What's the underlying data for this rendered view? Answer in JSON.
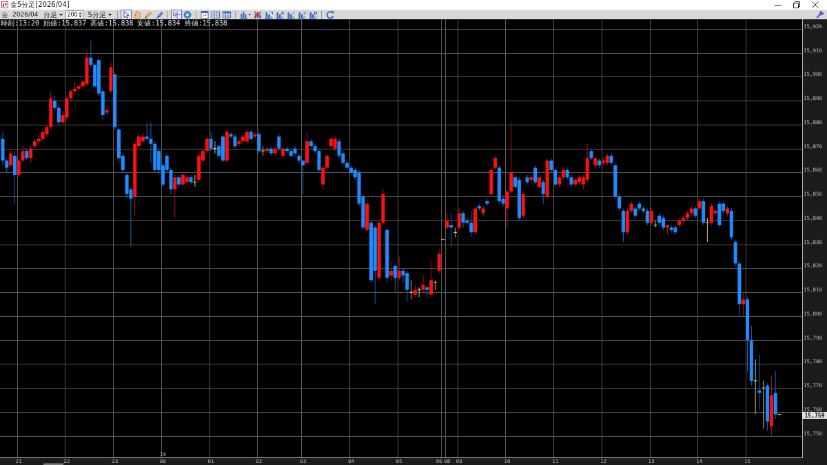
{
  "window": {
    "title": "金5分足[2026/04]"
  },
  "toolbar": {
    "symbol": "金",
    "contract": "2026/04",
    "unit": "分足",
    "bar_count": "200",
    "period": "5分足",
    "tools": [
      {
        "selected": true
      },
      {
        "selected": false
      },
      {
        "selected": false
      },
      {
        "selected": false
      },
      {
        "selected": true
      },
      {
        "selected": false
      },
      {
        "selected": false
      },
      {
        "selected": false
      },
      {
        "selected": false
      },
      {
        "selected": false
      },
      {
        "selected": false
      },
      {
        "selected": false
      },
      {
        "selected": false
      },
      {
        "selected": false
      },
      {
        "selected": false
      },
      {
        "selected": false
      },
      {
        "selected": false
      }
    ]
  },
  "chart": {
    "quote_line": "時刻:13:20 始値:15,837 高値:15,838 安値:15,834 終値:15,838",
    "chart_data": {
      "type": "candlestick",
      "categories": [
        null,
        null,
        null,
        null,
        "21",
        null,
        null,
        null,
        null,
        null,
        null,
        null,
        null,
        null,
        null,
        null,
        "22",
        null,
        null,
        null,
        null,
        null,
        null,
        null,
        null,
        null,
        null,
        null,
        "23",
        null,
        null,
        null,
        null,
        null,
        null,
        null,
        null,
        null,
        null,
        null,
        "00",
        null,
        null,
        null,
        null,
        null,
        null,
        null,
        null,
        null,
        null,
        null,
        "01",
        null,
        null,
        null,
        null,
        null,
        null,
        null,
        null,
        null,
        null,
        null,
        "02",
        null,
        null,
        null,
        null,
        null,
        null,
        null,
        null,
        null,
        null,
        "03",
        null,
        null,
        null,
        null,
        null,
        null,
        null,
        null,
        null,
        null,
        null,
        "04",
        null,
        null,
        null,
        null,
        null,
        null,
        null,
        null,
        null,
        null,
        null,
        "05",
        null,
        null,
        null,
        null,
        null,
        null,
        null,
        null,
        null,
        "06",
        null,
        "08",
        null,
        null,
        "09",
        null,
        null,
        null,
        null,
        null,
        null,
        null,
        null,
        null,
        null,
        null,
        "10",
        null,
        null,
        null,
        null,
        null,
        null,
        null,
        null,
        null,
        null,
        null,
        "11",
        null,
        null,
        null,
        null,
        null,
        null,
        null,
        null,
        null,
        null,
        null,
        "12",
        null,
        null,
        null,
        null,
        null,
        null,
        null,
        null,
        null,
        null,
        null,
        "13",
        null,
        null,
        null,
        null,
        null,
        null,
        null,
        null,
        null,
        null,
        null,
        "14",
        null,
        null,
        null,
        null,
        null,
        null,
        null,
        null,
        null,
        null,
        null,
        "15",
        null,
        null,
        null,
        null,
        null,
        null,
        null,
        null
      ],
      "ohlc": [
        [
          15874,
          15877,
          15863,
          15865
        ],
        [
          15865,
          15866,
          15860,
          15862
        ],
        [
          15863,
          15869,
          15862,
          15868
        ],
        [
          15867,
          15869,
          15847,
          15859
        ],
        [
          15859,
          15866,
          15858,
          15865
        ],
        [
          15865,
          15871,
          15864,
          15869
        ],
        [
          15869,
          15870,
          15865,
          15866
        ],
        [
          15866,
          15871,
          15864,
          15870
        ],
        [
          15871,
          15874,
          15870,
          15873
        ],
        [
          15873,
          15876,
          15872,
          15874
        ],
        [
          15874,
          15878,
          15873,
          15877
        ],
        [
          15876,
          15880,
          15875,
          15879
        ],
        [
          15879,
          15894,
          15878,
          15891
        ],
        [
          15890,
          15892,
          15886,
          15887
        ],
        [
          15887,
          15888,
          15880,
          15881
        ],
        [
          15881,
          15886,
          15880,
          15884
        ],
        [
          15883,
          15892,
          15882,
          15891
        ],
        [
          15891,
          15895,
          15890,
          15894
        ],
        [
          15894,
          15898,
          15893,
          15895
        ],
        [
          15895,
          15897,
          15894,
          15896
        ],
        [
          15896,
          15899,
          15895,
          15898
        ],
        [
          15897,
          15911,
          15896,
          15908
        ],
        [
          15908,
          15915,
          15904,
          15905
        ],
        [
          15905,
          15906,
          15895,
          15896
        ],
        [
          15907,
          15908,
          15892,
          15893
        ],
        [
          15894,
          15895,
          15882,
          15884
        ],
        [
          15885,
          15888,
          15884,
          15886
        ],
        [
          15894,
          15906,
          15893,
          15904
        ],
        [
          15901,
          15902,
          15878,
          15879
        ],
        [
          15878,
          15879,
          15864,
          15866
        ],
        [
          15867,
          15868,
          15860,
          15861
        ],
        [
          15859,
          15860,
          15849,
          15851
        ],
        [
          15853,
          15854,
          15829,
          15849
        ],
        [
          15850,
          15873,
          15842,
          15872
        ],
        [
          15871,
          15876,
          15870,
          15875
        ],
        [
          15873,
          15877,
          15872,
          15875
        ],
        [
          15875,
          15881,
          15873,
          15874
        ],
        [
          15874,
          15881,
          15864,
          15872
        ],
        [
          15872,
          15873,
          15860,
          15861
        ],
        [
          15869,
          15870,
          15859,
          15861
        ],
        [
          15863,
          15864,
          15854,
          15855
        ],
        [
          15867,
          15868,
          15860,
          15861
        ],
        [
          15861,
          15862,
          15851,
          15853
        ],
        [
          15853,
          15859,
          15841,
          15858
        ],
        [
          15858,
          15859,
          15854,
          15855
        ],
        [
          15855,
          15860,
          15854,
          15859
        ],
        [
          15856,
          15859,
          15855,
          15858
        ],
        [
          15858,
          15859,
          15855,
          15856
        ],
        [
          15856,
          15859,
          15854,
          15856
        ],
        [
          15857,
          15868,
          15856,
          15867
        ],
        [
          15865,
          15870,
          15864,
          15869
        ],
        [
          15869,
          15875,
          15868,
          15874
        ],
        [
          15874,
          15877,
          15869,
          15870
        ],
        [
          15870,
          15873,
          15868,
          15870
        ],
        [
          15871,
          15872,
          15866,
          15867
        ],
        [
          15875,
          15876,
          15864,
          15865
        ],
        [
          15865,
          15878,
          15864,
          15877
        ],
        [
          15876,
          15877,
          15874,
          15875
        ],
        [
          15875,
          15876,
          15870,
          15871
        ],
        [
          15872,
          15874,
          15871,
          15873
        ],
        [
          15873,
          15876,
          15872,
          15875
        ],
        [
          15873,
          15878,
          15872,
          15877
        ],
        [
          15877,
          15878,
          15873,
          15874
        ],
        [
          15875,
          15877,
          15874,
          15876
        ],
        [
          15876,
          15877,
          15868,
          15869
        ],
        [
          15869,
          15871,
          15867,
          15869
        ],
        [
          15869,
          15871,
          15868,
          15870
        ],
        [
          15870,
          15871,
          15867,
          15868
        ],
        [
          15868,
          15871,
          15867,
          15870
        ],
        [
          15875,
          15876,
          15869,
          15870
        ],
        [
          15867,
          15871,
          15866,
          15870
        ],
        [
          15870,
          15871,
          15868,
          15869
        ],
        [
          15869,
          15870,
          15866,
          15867
        ],
        [
          15870,
          15871,
          15867,
          15868
        ],
        [
          15867,
          15868,
          15864,
          15865
        ],
        [
          15865,
          15865,
          15851,
          15863
        ],
        [
          15864,
          15877,
          15863,
          15873
        ],
        [
          15873,
          15874,
          15870,
          15871
        ],
        [
          15871,
          15872,
          15868,
          15869
        ],
        [
          15869,
          15870,
          15860,
          15861
        ],
        [
          15855,
          15863,
          15853,
          15862
        ],
        [
          15862,
          15868,
          15861,
          15867
        ],
        [
          15871,
          15875,
          15870,
          15874
        ],
        [
          15870,
          15875,
          15869,
          15874
        ],
        [
          15873,
          15874,
          15866,
          15867
        ],
        [
          15868,
          15869,
          15863,
          15864
        ],
        [
          15864,
          15865,
          15861,
          15862
        ],
        [
          15862,
          15863,
          15859,
          15860
        ],
        [
          15861,
          15862,
          15857,
          15858
        ],
        [
          15860,
          15861,
          15846,
          15847
        ],
        [
          15850,
          15851,
          15836,
          15837
        ],
        [
          15836,
          15849,
          15835,
          15847
        ],
        [
          15839,
          15840,
          15814,
          15815
        ],
        [
          15837,
          15838,
          15805,
          15819
        ],
        [
          15816,
          15840,
          15815,
          15839
        ],
        [
          15839,
          15853,
          15838,
          15851
        ],
        [
          15836,
          15837,
          15814,
          15816
        ],
        [
          15817,
          15823,
          15815,
          15819
        ],
        [
          15821,
          15822,
          15810,
          15816
        ],
        [
          15816,
          15825,
          15815,
          15819
        ],
        [
          15819,
          15820,
          15814,
          15817
        ],
        [
          15818,
          15819,
          15806,
          15811
        ],
        [
          15810,
          15815,
          15807,
          15810
        ],
        [
          15809,
          15813,
          15808,
          15811
        ],
        [
          15811,
          15812,
          15808,
          15811
        ],
        [
          15811,
          15817,
          15810,
          15813
        ],
        [
          15812,
          15813,
          15808,
          15811
        ],
        [
          15809,
          15823,
          15809,
          15815
        ],
        [
          15814,
          15815,
          15811,
          15814
        ],
        [
          15819,
          15828,
          15818,
          15826
        ],
        [
          15832,
          15832,
          15832,
          15832
        ],
        [
          15837,
          15843,
          15836,
          15840
        ],
        [
          15838,
          15843,
          15829,
          15837
        ],
        [
          15835,
          15837,
          15833,
          15835
        ],
        [
          15837,
          15845,
          15836,
          15843
        ],
        [
          15843,
          15844,
          15837,
          15839
        ],
        [
          15840,
          15841,
          15838,
          15839
        ],
        [
          15839,
          15844,
          15833,
          15835
        ],
        [
          15835,
          15846,
          15834,
          15845
        ],
        [
          15846,
          15847,
          15844,
          15845
        ],
        [
          15843,
          15846,
          15842,
          15845
        ],
        [
          15848,
          15849,
          15846,
          15847
        ],
        [
          15851,
          15862,
          15850,
          15861
        ],
        [
          15862,
          15867,
          15861,
          15866
        ],
        [
          15862,
          15863,
          15847,
          15848
        ],
        [
          15849,
          15850,
          15846,
          15847
        ],
        [
          15845,
          15853,
          15837,
          15852
        ],
        [
          15852,
          15881,
          15851,
          15860
        ],
        [
          15858,
          15859,
          15853,
          15854
        ],
        [
          15857,
          15858,
          15840,
          15841
        ],
        [
          15842,
          15852,
          15841,
          15851
        ],
        [
          15858,
          15859,
          15855,
          15856
        ],
        [
          15857,
          15859,
          15856,
          15858
        ],
        [
          15862,
          15863,
          15855,
          15856
        ],
        [
          15854,
          15859,
          15853,
          15858
        ],
        [
          15856,
          15857,
          15847,
          15851
        ],
        [
          15850,
          15866,
          15849,
          15865
        ],
        [
          15865,
          15866,
          15860,
          15861
        ],
        [
          15861,
          15862,
          15854,
          15855
        ],
        [
          15855,
          15859,
          15854,
          15858
        ],
        [
          15858,
          15862,
          15857,
          15861
        ],
        [
          15861,
          15862,
          15857,
          15858
        ],
        [
          15858,
          15859,
          15854,
          15855
        ],
        [
          15855,
          15858,
          15854,
          15857
        ],
        [
          15856,
          15859,
          15855,
          15858
        ],
        [
          15855,
          15859,
          15853,
          15858
        ],
        [
          15857,
          15872,
          15856,
          15866
        ],
        [
          15869,
          15870,
          15865,
          15866
        ],
        [
          15863,
          15867,
          15862,
          15866
        ],
        [
          15865,
          15866,
          15862,
          15863
        ],
        [
          15864,
          15866,
          15863,
          15865
        ],
        [
          15864,
          15868,
          15863,
          15867
        ],
        [
          15867,
          15868,
          15863,
          15864
        ],
        [
          15863,
          15864,
          15849,
          15850
        ],
        [
          15850,
          15851,
          15844,
          15845
        ],
        [
          15844,
          15845,
          15831,
          15835
        ],
        [
          15835,
          15845,
          15834,
          15844
        ],
        [
          15844,
          15848,
          15843,
          15847
        ],
        [
          15845,
          15846,
          15841,
          15842
        ],
        [
          15847,
          15848,
          15844,
          15845
        ],
        [
          15845,
          15846,
          15843,
          15844
        ],
        [
          15844,
          15845,
          15838,
          15839
        ],
        [
          15839,
          15845,
          15838,
          15844
        ],
        [
          15838,
          15840,
          15837,
          15838
        ],
        [
          15842,
          15843,
          15838,
          15839
        ],
        [
          15841,
          15842,
          15836,
          15837
        ],
        [
          15837,
          15838,
          15834,
          15838
        ],
        [
          15837,
          15838,
          15835,
          15836
        ],
        [
          15837,
          15838,
          15834,
          15835
        ],
        [
          15838,
          15841,
          15837,
          15840
        ],
        [
          15840,
          15842,
          15839,
          15841
        ],
        [
          15841,
          15844,
          15840,
          15843
        ],
        [
          15843,
          15846,
          15842,
          15845
        ],
        [
          15845,
          15846,
          15841,
          15842
        ],
        [
          15845,
          15849,
          15844,
          15848
        ],
        [
          15848,
          15849,
          15838,
          15839
        ],
        [
          15839,
          15841,
          15831,
          15839
        ],
        [
          15839,
          15847,
          15838,
          15846
        ],
        [
          15843,
          15845,
          15842,
          15844
        ],
        [
          15847,
          15848,
          15837,
          15838
        ],
        [
          15847,
          15848,
          15843,
          15844
        ],
        [
          15843,
          15846,
          15842,
          15845
        ],
        [
          15844,
          15845,
          15832,
          15833
        ],
        [
          15831,
          15832,
          15821,
          15822
        ],
        [
          15822,
          15823,
          15800,
          15805
        ],
        [
          15805,
          15810,
          15800,
          15807
        ],
        [
          15807,
          15808,
          15777,
          15790
        ],
        [
          15790,
          15796,
          15771,
          15773
        ],
        [
          15773,
          15782,
          15759,
          15773
        ],
        [
          15769,
          15784,
          15761,
          15768
        ],
        [
          15770,
          15773,
          15753,
          15770
        ],
        [
          15771,
          15772,
          15752,
          15756
        ],
        [
          15754,
          15775,
          15750,
          15767
        ],
        [
          15768,
          15777,
          15757,
          15759
        ],
        [
          15759,
          15759,
          15759,
          15759
        ]
      ],
      "ylim": [
        15741,
        15924
      ],
      "yticks": [
        {
          "value": 15920,
          "label": "15,920"
        },
        {
          "value": 15910,
          "label": "15,910"
        },
        {
          "value": 15900,
          "label": "15,900"
        },
        {
          "value": 15890,
          "label": "15,890"
        },
        {
          "value": 15880,
          "label": "15,880"
        },
        {
          "value": 15870,
          "label": "15,870"
        },
        {
          "value": 15860,
          "label": "15,860"
        },
        {
          "value": 15850,
          "label": "15,850"
        },
        {
          "value": 15840,
          "label": "15,840"
        },
        {
          "value": 15830,
          "label": "15,830"
        },
        {
          "value": 15820,
          "label": "15,820"
        },
        {
          "value": 15810,
          "label": "15,810"
        },
        {
          "value": 15800,
          "label": "15,800"
        },
        {
          "value": 15790,
          "label": "15,790"
        },
        {
          "value": 15780,
          "label": "15,780"
        },
        {
          "value": 15770,
          "label": "15,770"
        },
        {
          "value": 15760,
          "label": "15,760"
        },
        {
          "value": 15750,
          "label": "15,750"
        }
      ],
      "grid": true,
      "annotations": [
        "19"
      ]
    },
    "last_price": "15,759"
  }
}
